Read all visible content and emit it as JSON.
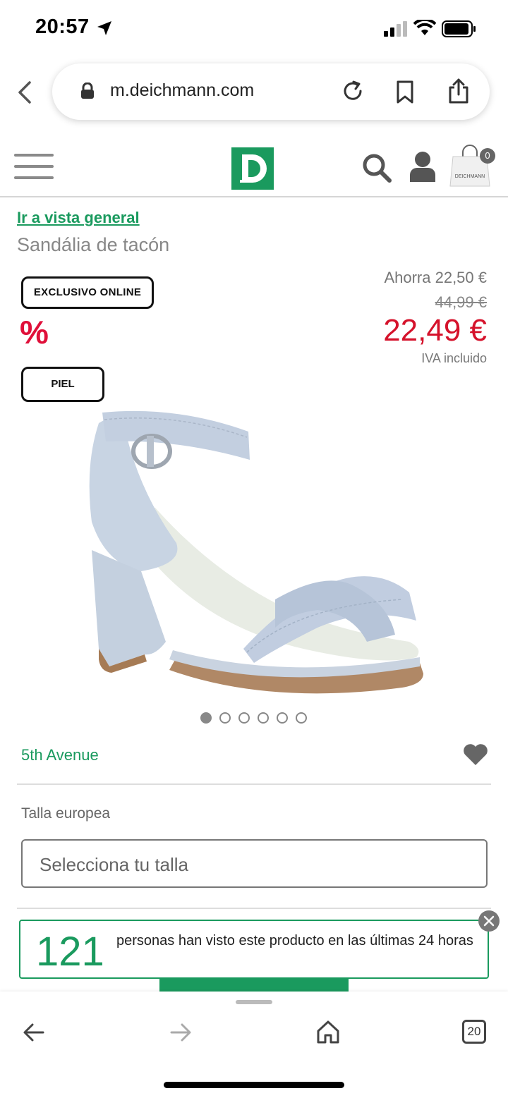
{
  "status": {
    "time": "20:57"
  },
  "browser": {
    "url": "m.deichmann.com",
    "tabs_count": "20"
  },
  "header": {
    "logo_letter": "D",
    "cart_count": "0",
    "bag_brand": "DEICHMANN"
  },
  "product": {
    "back_link": "Ir a vista general",
    "title": "Sandália de tacón",
    "badge_online": "EXCLUSIVO ONLINE",
    "discount_symbol": "%",
    "badge_material": "PIEL",
    "savings": "Ahorra 22,50 €",
    "old_price": "44,99 €",
    "price": "22,49 €",
    "vat": "IVA incluido",
    "image_count": 6,
    "active_image": 1,
    "brand": "5th Avenue"
  },
  "size": {
    "label": "Talla europea",
    "placeholder": "Selecciona tu talla"
  },
  "viewers": {
    "count": "121",
    "text": "personas han visto este producto en las últimas 24 horas"
  },
  "colors": {
    "brand_green": "#1a9a5e",
    "price_red": "#d5122b",
    "percent_red": "#e0103a"
  }
}
